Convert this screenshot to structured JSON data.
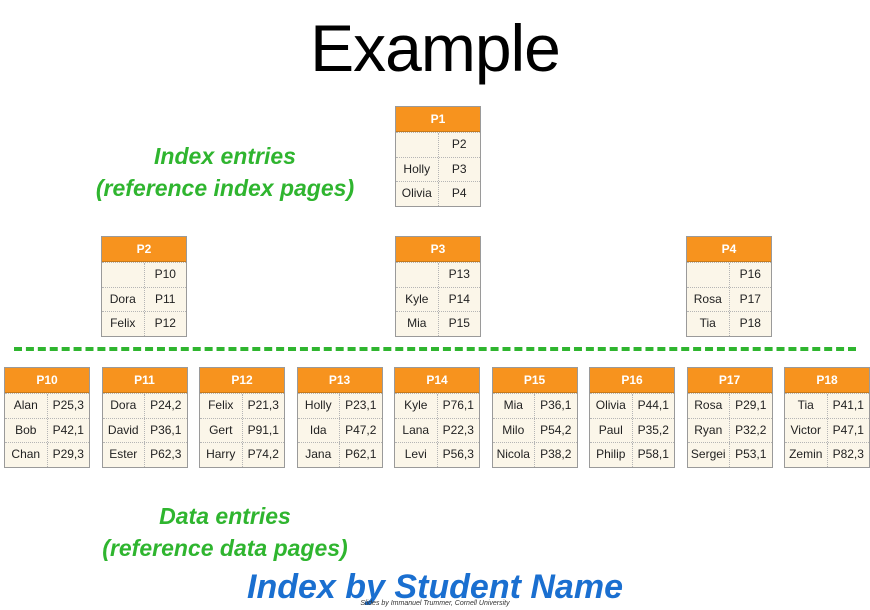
{
  "title": "Example",
  "index_label": {
    "line1": "Index entries",
    "line2": "(reference index pages)"
  },
  "data_label": {
    "line1": "Data entries",
    "line2": "(reference data pages)"
  },
  "footer_title": "Index by Student Name",
  "credit": "Slides by Immanuel Trummer, Cornell University",
  "colors": {
    "header": "#f7931e",
    "green": "#2fb52f",
    "blue": "#1a6fd0",
    "cell_bg": "#fbf6e9"
  },
  "root": {
    "name": "P1",
    "rows": [
      [
        "",
        "P2"
      ],
      [
        "Holly",
        "P3"
      ],
      [
        "Olivia",
        "P4"
      ]
    ]
  },
  "inner": [
    {
      "name": "P2",
      "rows": [
        [
          "",
          "P10"
        ],
        [
          "Dora",
          "P11"
        ],
        [
          "Felix",
          "P12"
        ]
      ]
    },
    {
      "name": "P3",
      "rows": [
        [
          "",
          "P13"
        ],
        [
          "Kyle",
          "P14"
        ],
        [
          "Mia",
          "P15"
        ]
      ]
    },
    {
      "name": "P4",
      "rows": [
        [
          "",
          "P16"
        ],
        [
          "Rosa",
          "P17"
        ],
        [
          "Tia",
          "P18"
        ]
      ]
    }
  ],
  "leaves": [
    {
      "name": "P10",
      "rows": [
        [
          "Alan",
          "P25,3"
        ],
        [
          "Bob",
          "P42,1"
        ],
        [
          "Chan",
          "P29,3"
        ]
      ]
    },
    {
      "name": "P11",
      "rows": [
        [
          "Dora",
          "P24,2"
        ],
        [
          "David",
          "P36,1"
        ],
        [
          "Ester",
          "P62,3"
        ]
      ]
    },
    {
      "name": "P12",
      "rows": [
        [
          "Felix",
          "P21,3"
        ],
        [
          "Gert",
          "P91,1"
        ],
        [
          "Harry",
          "P74,2"
        ]
      ]
    },
    {
      "name": "P13",
      "rows": [
        [
          "Holly",
          "P23,1"
        ],
        [
          "Ida",
          "P47,2"
        ],
        [
          "Jana",
          "P62,1"
        ]
      ]
    },
    {
      "name": "P14",
      "rows": [
        [
          "Kyle",
          "P76,1"
        ],
        [
          "Lana",
          "P22,3"
        ],
        [
          "Levi",
          "P56,3"
        ]
      ]
    },
    {
      "name": "P15",
      "rows": [
        [
          "Mia",
          "P36,1"
        ],
        [
          "Milo",
          "P54,2"
        ],
        [
          "Nicola",
          "P38,2"
        ]
      ]
    },
    {
      "name": "P16",
      "rows": [
        [
          "Olivia",
          "P44,1"
        ],
        [
          "Paul",
          "P35,2"
        ],
        [
          "Philip",
          "P58,1"
        ]
      ]
    },
    {
      "name": "P17",
      "rows": [
        [
          "Rosa",
          "P29,1"
        ],
        [
          "Ryan",
          "P32,2"
        ],
        [
          "Sergei",
          "P53,1"
        ]
      ]
    },
    {
      "name": "P18",
      "rows": [
        [
          "Tia",
          "P41,1"
        ],
        [
          "Victor",
          "P47,1"
        ],
        [
          "Zemin",
          "P82,3"
        ]
      ]
    }
  ]
}
